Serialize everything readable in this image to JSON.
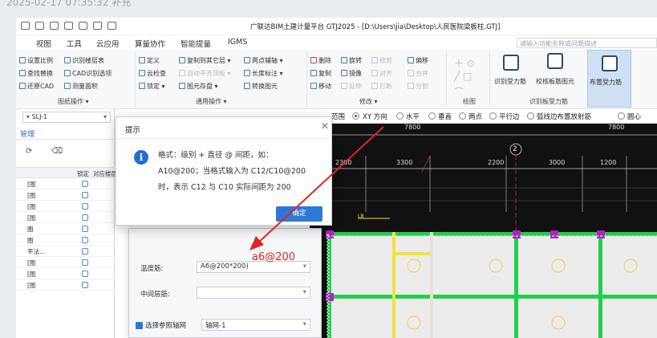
{
  "caption": "2025-02-17 07:35:32 补充",
  "app": {
    "title": "广联达BIM土建计量平台 GTJ2025 - [D:\\Users\\jia\\Desktop\\人民医院梁板柱.GTJ]"
  },
  "menu": [
    "视图",
    "工具",
    "云应用",
    "算量协作",
    "智能提量",
    "IGMS"
  ],
  "search": {
    "placeholder": "请输入功能名称或问题描述"
  },
  "ribbon": {
    "col1": [
      "设置比例",
      "查找替换",
      "还原CAD"
    ],
    "col2": [
      "识别楼层表",
      "CAD识别选项",
      "测量面积"
    ],
    "group1": "图纸操作",
    "col3": [
      "定义",
      "云检查",
      "锁定"
    ],
    "col4": [
      "复制到其它层",
      "自动平齐顶板",
      "图元存盘"
    ],
    "col5": [
      "两点辅轴",
      "长度标注",
      "转换图元"
    ],
    "group2": "通用操作",
    "col6": [
      "删除",
      "复制",
      "移动"
    ],
    "col7": [
      "旋转",
      "镜像",
      "延伸"
    ],
    "col8": [
      "修剪",
      "对齐",
      "打断"
    ],
    "col9": [
      "偏移",
      "合并",
      "分割"
    ],
    "group3": "修改",
    "group4": "绘图",
    "big": [
      "识别受力筋",
      "校核板筋图元",
      "布置受力筋"
    ],
    "group5": "识别板受力筋"
  },
  "left": {
    "combo_value": "SLJ-1",
    "tab": "管理",
    "columns": [
      "锁定",
      "对应楼层"
    ],
    "rows": [
      "[图",
      "[图",
      "[图",
      "[图",
      "图",
      "图",
      "平法...",
      "[图",
      "[图",
      "[图"
    ]
  },
  "cadbar": {
    "scope_label": "范围",
    "options": [
      "XY 方向",
      "水平",
      "垂直",
      "两点",
      "平行边",
      "弧线边布置放射筋",
      "圆心"
    ],
    "selected": "XY 方向"
  },
  "canvas": {
    "top_dims": [
      "7800",
      "7800"
    ],
    "dims": [
      "2300",
      "3300",
      "2200",
      "3000",
      "1200"
    ],
    "axis": "2",
    "small_label": "LB"
  },
  "tip": {
    "title": "提示",
    "lines": [
      "格式：级别 + 直径 @ 间距，如：",
      "A10@200；当格式输入为 C12/C10@200",
      "时，表示 C12 与 C10 实际间距为 200"
    ],
    "ok": "确定"
  },
  "form": {
    "temp_label": "温度筋:",
    "temp_value": "A6@200*200)",
    "mid_label": "中间层筋:",
    "mid_value": "",
    "axis_check": "选择参照轴网",
    "axis_value": "轴网-1"
  },
  "annotation": "a6@200",
  "colors": {
    "accent": "#2e79d6",
    "annotation": "#e02424",
    "canvas": "#111111",
    "beam_green": "#1fd14a",
    "wall_yellow": "#f0e33a",
    "purple": "#b020c8"
  }
}
